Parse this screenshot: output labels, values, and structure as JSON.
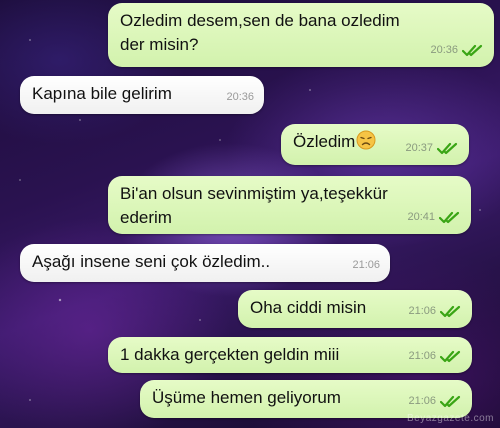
{
  "messages": [
    {
      "direction": "outgoing",
      "lines": [
        "Ozledim desem,sen de bana ozledim",
        "der misin?"
      ],
      "time": "20:36",
      "read": true
    },
    {
      "direction": "incoming",
      "lines": [
        "Kapına bile gelirim"
      ],
      "time": "20:36"
    },
    {
      "direction": "outgoing",
      "lines": [
        "Özledim"
      ],
      "emoji": "disappointed-face",
      "time": "20:37",
      "read": true
    },
    {
      "direction": "outgoing",
      "lines": [
        "Bi'an olsun sevinmiştim ya,teşekkür",
        "ederim"
      ],
      "time": "20:41",
      "read": true
    },
    {
      "direction": "incoming",
      "lines": [
        "Aşağı insene seni çok özledim.."
      ],
      "time": "21:06"
    },
    {
      "direction": "outgoing",
      "lines": [
        "Oha ciddi misin"
      ],
      "time": "21:06",
      "read": true
    },
    {
      "direction": "outgoing",
      "lines": [
        "1 dakka gerçekten geldin miii"
      ],
      "time": "21:06",
      "read": true
    },
    {
      "direction": "outgoing",
      "lines": [
        "Üşüme hemen geliyorum"
      ],
      "time": "21:06",
      "read": true
    }
  ],
  "watermark": "Beyazgazete.com",
  "colors": {
    "outgoing_bubble": "#dcf8c6",
    "incoming_bubble": "#ffffff",
    "read_check": "#3aa515"
  },
  "icons": {
    "read_receipt": "double-check-icon",
    "emoji": "disappointed-face-emoji"
  }
}
